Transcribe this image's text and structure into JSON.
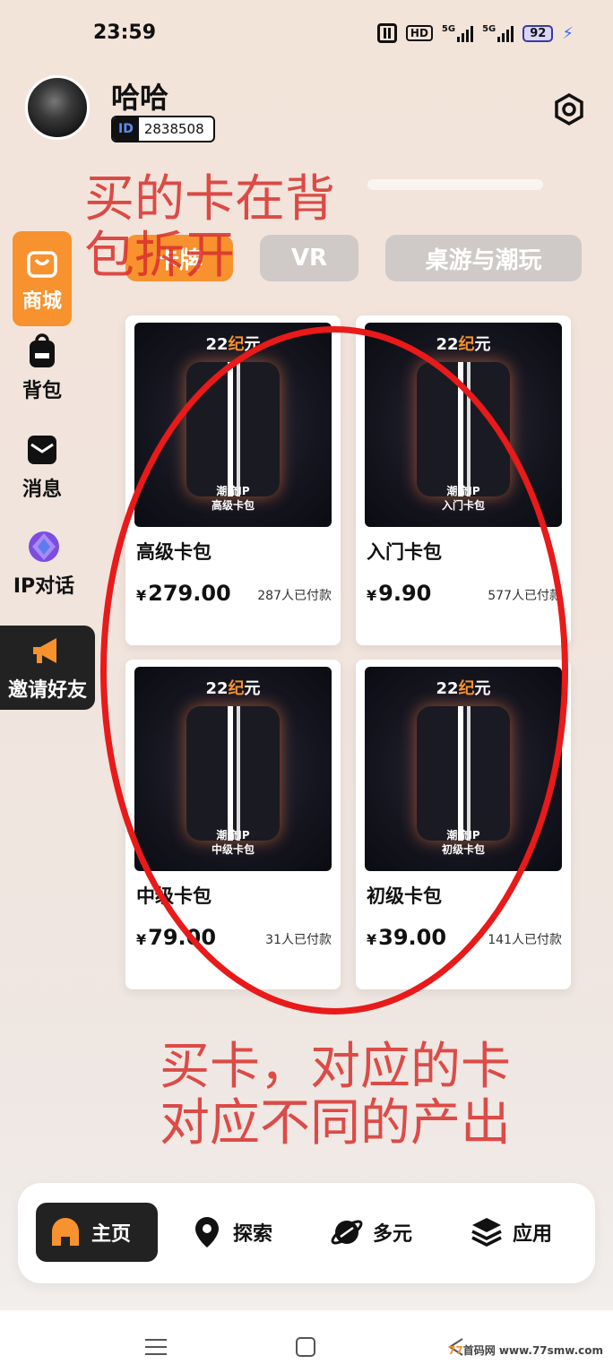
{
  "status_bar": {
    "time": "23:59",
    "hd_label": "HD",
    "signal1_label": "5G",
    "signal2_label": "5G",
    "battery": "92",
    "icons": [
      "nfc-icon",
      "hd-icon",
      "signal-icon",
      "signal-icon",
      "battery-icon",
      "charging-bolt-icon"
    ]
  },
  "profile": {
    "name": "哈哈",
    "id_tag": "ID",
    "id_value": "2838508"
  },
  "annotations": {
    "top": "买的卡在背包拆开",
    "bottom": "买卡，对应的卡对应不同的产出"
  },
  "tabs": [
    {
      "label": "卡牌",
      "active": true
    },
    {
      "label": "VR",
      "active": false
    },
    {
      "label": "桌游与潮玩",
      "active": false
    }
  ],
  "side_nav": {
    "shop": "商城",
    "bag": "背包",
    "messages": "消息",
    "ip_chat": "IP对话",
    "invite": "邀请好友"
  },
  "products": [
    {
      "brand_a": "22",
      "brand_b": "纪",
      "brand_c": "元",
      "cap1": "潮流IP",
      "cap2": "高级卡包",
      "title": "高级卡包",
      "currency": "¥",
      "price": "279.00",
      "sold": "287人已付款"
    },
    {
      "brand_a": "22",
      "brand_b": "纪",
      "brand_c": "元",
      "cap1": "潮流IP",
      "cap2": "入门卡包",
      "title": "入门卡包",
      "currency": "¥",
      "price": "9.90",
      "sold": "577人已付款"
    },
    {
      "brand_a": "22",
      "brand_b": "纪",
      "brand_c": "元",
      "cap1": "潮流IP",
      "cap2": "中级卡包",
      "title": "中级卡包",
      "currency": "¥",
      "price": "79.00",
      "sold": "31人已付款"
    },
    {
      "brand_a": "22",
      "brand_b": "纪",
      "brand_c": "元",
      "cap1": "潮流IP",
      "cap2": "初级卡包",
      "title": "初级卡包",
      "currency": "¥",
      "price": "39.00",
      "sold": "141人已付款"
    }
  ],
  "bottom_nav": [
    {
      "label": "主页",
      "icon": "home-icon",
      "active": true
    },
    {
      "label": "探索",
      "icon": "location-pin-icon",
      "active": false
    },
    {
      "label": "多元",
      "icon": "planet-icon",
      "active": false
    },
    {
      "label": "应用",
      "icon": "layers-icon",
      "active": false
    }
  ],
  "watermark": {
    "prefix": "77",
    "site": "首码网",
    "url": "www.77smw.com"
  },
  "colors": {
    "accent": "#f7922e",
    "dark": "#222222",
    "annotation_red": "#d9302c",
    "ellipse_red": "#e81a1a"
  }
}
